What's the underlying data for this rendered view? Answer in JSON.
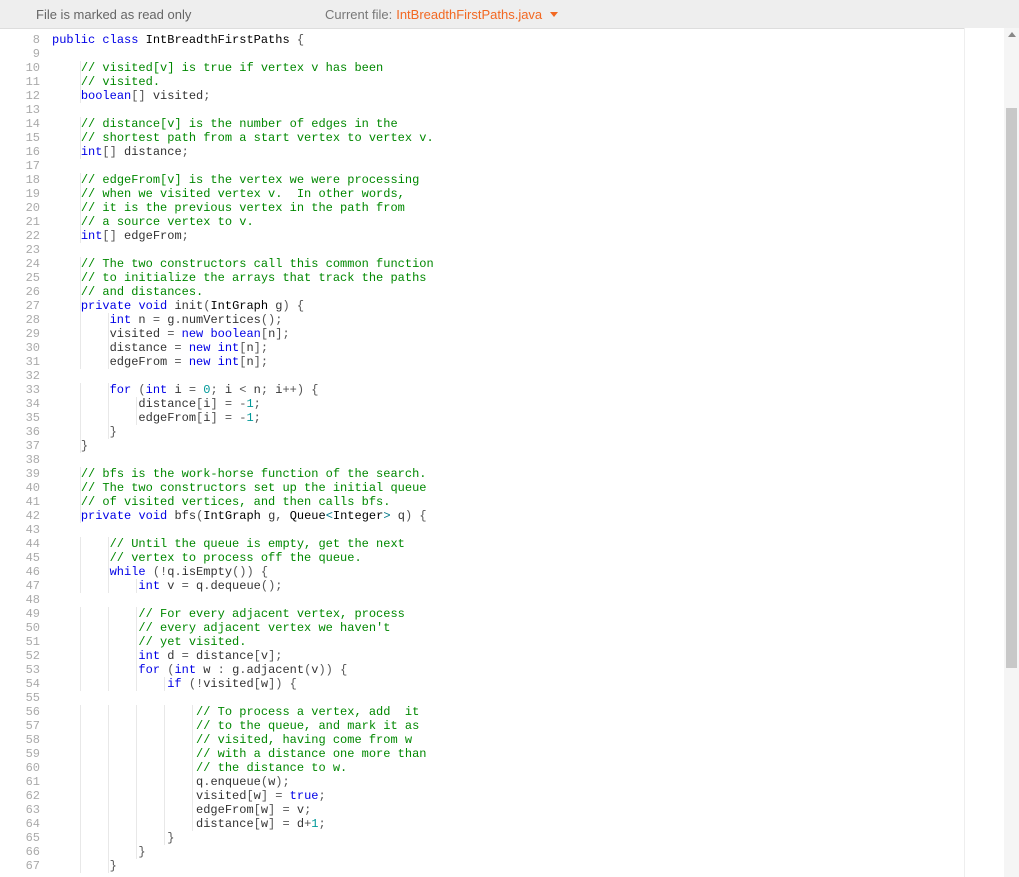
{
  "topbar": {
    "readonly_msg": "File is marked as read only",
    "current_label": "Current file:",
    "current_file": "IntBreadthFirstPaths.java"
  },
  "gutter": {
    "start": 8,
    "end": 67
  },
  "code": {
    "lines": [
      [
        [
          "kw",
          "public"
        ],
        [
          "",
          ""
        ],
        [
          "kw",
          "class"
        ],
        [
          "",
          ""
        ],
        [
          "type",
          "IntBreadthFirstPaths"
        ],
        [
          "",
          ""
        ],
        [
          "punc",
          "{"
        ]
      ],
      [],
      [
        [
          "",
          "    "
        ],
        [
          "comment",
          "// visited[v] is true if vertex v has been"
        ]
      ],
      [
        [
          "",
          "    "
        ],
        [
          "comment",
          "// visited."
        ]
      ],
      [
        [
          "",
          "    "
        ],
        [
          "kw",
          "boolean"
        ],
        [
          "punc",
          "[]"
        ],
        [
          "",
          ""
        ],
        [
          "id",
          "visited"
        ],
        [
          "punc",
          ";"
        ]
      ],
      [],
      [
        [
          "",
          "    "
        ],
        [
          "comment",
          "// distance[v] is the number of edges in the"
        ]
      ],
      [
        [
          "",
          "    "
        ],
        [
          "comment",
          "// shortest path from a start vertex to vertex v."
        ]
      ],
      [
        [
          "",
          "    "
        ],
        [
          "kw",
          "int"
        ],
        [
          "punc",
          "[]"
        ],
        [
          "",
          ""
        ],
        [
          "id",
          "distance"
        ],
        [
          "punc",
          ";"
        ]
      ],
      [],
      [
        [
          "",
          "    "
        ],
        [
          "comment",
          "// edgeFrom[v] is the vertex we were processing"
        ]
      ],
      [
        [
          "",
          "    "
        ],
        [
          "comment",
          "// when we visited vertex v.  In other words,"
        ]
      ],
      [
        [
          "",
          "    "
        ],
        [
          "comment",
          "// it is the previous vertex in the path from"
        ]
      ],
      [
        [
          "",
          "    "
        ],
        [
          "comment",
          "// a source vertex to v."
        ]
      ],
      [
        [
          "",
          "    "
        ],
        [
          "kw",
          "int"
        ],
        [
          "punc",
          "[]"
        ],
        [
          "",
          ""
        ],
        [
          "id",
          "edgeFrom"
        ],
        [
          "punc",
          ";"
        ]
      ],
      [],
      [
        [
          "",
          "    "
        ],
        [
          "comment",
          "// The two constructors call this common function"
        ]
      ],
      [
        [
          "",
          "    "
        ],
        [
          "comment",
          "// to initialize the arrays that track the paths"
        ]
      ],
      [
        [
          "",
          "    "
        ],
        [
          "comment",
          "// and distances."
        ]
      ],
      [
        [
          "",
          "    "
        ],
        [
          "kw",
          "private"
        ],
        [
          "",
          ""
        ],
        [
          "kw",
          "void"
        ],
        [
          "",
          ""
        ],
        [
          "id",
          "init"
        ],
        [
          "punc",
          "("
        ],
        [
          "type",
          "IntGraph"
        ],
        [
          "",
          ""
        ],
        [
          "id",
          "g"
        ],
        [
          "punc",
          ")"
        ],
        [
          "",
          ""
        ],
        [
          "punc",
          "{"
        ]
      ],
      [
        [
          "",
          "        "
        ],
        [
          "kw",
          "int"
        ],
        [
          "",
          ""
        ],
        [
          "id",
          "n"
        ],
        [
          "",
          ""
        ],
        [
          "op",
          "="
        ],
        [
          "",
          ""
        ],
        [
          "id",
          "g"
        ],
        [
          "punc",
          "."
        ],
        [
          "id",
          "numVertices"
        ],
        [
          "punc",
          "();"
        ]
      ],
      [
        [
          "",
          "        "
        ],
        [
          "id",
          "visited"
        ],
        [
          "",
          ""
        ],
        [
          "op",
          "="
        ],
        [
          "",
          ""
        ],
        [
          "kw",
          "new"
        ],
        [
          "",
          ""
        ],
        [
          "kw",
          "boolean"
        ],
        [
          "punc",
          "["
        ],
        [
          "id",
          "n"
        ],
        [
          "punc",
          "];"
        ]
      ],
      [
        [
          "",
          "        "
        ],
        [
          "id",
          "distance"
        ],
        [
          "",
          ""
        ],
        [
          "op",
          "="
        ],
        [
          "",
          ""
        ],
        [
          "kw",
          "new"
        ],
        [
          "",
          ""
        ],
        [
          "kw",
          "int"
        ],
        [
          "punc",
          "["
        ],
        [
          "id",
          "n"
        ],
        [
          "punc",
          "];"
        ]
      ],
      [
        [
          "",
          "        "
        ],
        [
          "id",
          "edgeFrom"
        ],
        [
          "",
          ""
        ],
        [
          "op",
          "="
        ],
        [
          "",
          ""
        ],
        [
          "kw",
          "new"
        ],
        [
          "",
          ""
        ],
        [
          "kw",
          "int"
        ],
        [
          "punc",
          "["
        ],
        [
          "id",
          "n"
        ],
        [
          "punc",
          "];"
        ]
      ],
      [],
      [
        [
          "",
          "        "
        ],
        [
          "kw",
          "for"
        ],
        [
          "",
          ""
        ],
        [
          "punc",
          "("
        ],
        [
          "kw",
          "int"
        ],
        [
          "",
          ""
        ],
        [
          "id",
          "i"
        ],
        [
          "",
          ""
        ],
        [
          "op",
          "="
        ],
        [
          "",
          ""
        ],
        [
          "num",
          "0"
        ],
        [
          "punc",
          ";"
        ],
        [
          "",
          ""
        ],
        [
          "id",
          "i"
        ],
        [
          "",
          ""
        ],
        [
          "op",
          "<"
        ],
        [
          "",
          ""
        ],
        [
          "id",
          "n"
        ],
        [
          "punc",
          ";"
        ],
        [
          "",
          ""
        ],
        [
          "id",
          "i"
        ],
        [
          "op",
          "++"
        ],
        [
          "punc",
          ")"
        ],
        [
          "",
          ""
        ],
        [
          "punc",
          "{"
        ]
      ],
      [
        [
          "",
          "            "
        ],
        [
          "id",
          "distance"
        ],
        [
          "punc",
          "["
        ],
        [
          "id",
          "i"
        ],
        [
          "punc",
          "]"
        ],
        [
          "",
          ""
        ],
        [
          "op",
          "="
        ],
        [
          "",
          ""
        ],
        [
          "op",
          "-"
        ],
        [
          "num",
          "1"
        ],
        [
          "punc",
          ";"
        ]
      ],
      [
        [
          "",
          "            "
        ],
        [
          "id",
          "edgeFrom"
        ],
        [
          "punc",
          "["
        ],
        [
          "id",
          "i"
        ],
        [
          "punc",
          "]"
        ],
        [
          "",
          ""
        ],
        [
          "op",
          "="
        ],
        [
          "",
          ""
        ],
        [
          "op",
          "-"
        ],
        [
          "num",
          "1"
        ],
        [
          "punc",
          ";"
        ]
      ],
      [
        [
          "",
          "        "
        ],
        [
          "punc",
          "}"
        ]
      ],
      [
        [
          "",
          "    "
        ],
        [
          "punc",
          "}"
        ]
      ],
      [],
      [
        [
          "",
          "    "
        ],
        [
          "comment",
          "// bfs is the work-horse function of the search."
        ]
      ],
      [
        [
          "",
          "    "
        ],
        [
          "comment",
          "// The two constructors set up the initial queue"
        ]
      ],
      [
        [
          "",
          "    "
        ],
        [
          "comment",
          "// of visited vertices, and then calls bfs."
        ]
      ],
      [
        [
          "",
          "    "
        ],
        [
          "kw",
          "private"
        ],
        [
          "",
          ""
        ],
        [
          "kw",
          "void"
        ],
        [
          "",
          ""
        ],
        [
          "id",
          "bfs"
        ],
        [
          "punc",
          "("
        ],
        [
          "type",
          "IntGraph"
        ],
        [
          "",
          ""
        ],
        [
          "id",
          "g"
        ],
        [
          "punc",
          ","
        ],
        [
          "",
          ""
        ],
        [
          "type",
          "Queue"
        ],
        [
          "generic",
          "<"
        ],
        [
          "type",
          "Integer"
        ],
        [
          "generic",
          ">"
        ],
        [
          "",
          ""
        ],
        [
          "id",
          "q"
        ],
        [
          "punc",
          ")"
        ],
        [
          "",
          ""
        ],
        [
          "punc",
          "{"
        ]
      ],
      [],
      [
        [
          "",
          "        "
        ],
        [
          "comment",
          "// Until the queue is empty, get the next"
        ]
      ],
      [
        [
          "",
          "        "
        ],
        [
          "comment",
          "// vertex to process off the queue."
        ]
      ],
      [
        [
          "",
          "        "
        ],
        [
          "kw",
          "while"
        ],
        [
          "",
          ""
        ],
        [
          "punc",
          "("
        ],
        [
          "op",
          "!"
        ],
        [
          "id",
          "q"
        ],
        [
          "punc",
          "."
        ],
        [
          "id",
          "isEmpty"
        ],
        [
          "punc",
          "())"
        ],
        [
          "",
          ""
        ],
        [
          "punc",
          "{"
        ]
      ],
      [
        [
          "",
          "            "
        ],
        [
          "kw",
          "int"
        ],
        [
          "",
          ""
        ],
        [
          "id",
          "v"
        ],
        [
          "",
          ""
        ],
        [
          "op",
          "="
        ],
        [
          "",
          ""
        ],
        [
          "id",
          "q"
        ],
        [
          "punc",
          "."
        ],
        [
          "id",
          "dequeue"
        ],
        [
          "punc",
          "();"
        ]
      ],
      [],
      [
        [
          "",
          "            "
        ],
        [
          "comment",
          "// For every adjacent vertex, process"
        ]
      ],
      [
        [
          "",
          "            "
        ],
        [
          "comment",
          "// every adjacent vertex we haven't"
        ]
      ],
      [
        [
          "",
          "            "
        ],
        [
          "comment",
          "// yet visited."
        ]
      ],
      [
        [
          "",
          "            "
        ],
        [
          "kw",
          "int"
        ],
        [
          "",
          ""
        ],
        [
          "id",
          "d"
        ],
        [
          "",
          ""
        ],
        [
          "op",
          "="
        ],
        [
          "",
          ""
        ],
        [
          "id",
          "distance"
        ],
        [
          "punc",
          "["
        ],
        [
          "id",
          "v"
        ],
        [
          "punc",
          "];"
        ]
      ],
      [
        [
          "",
          "            "
        ],
        [
          "kw",
          "for"
        ],
        [
          "",
          ""
        ],
        [
          "punc",
          "("
        ],
        [
          "kw",
          "int"
        ],
        [
          "",
          ""
        ],
        [
          "id",
          "w"
        ],
        [
          "",
          ""
        ],
        [
          "op",
          ":"
        ],
        [
          "",
          ""
        ],
        [
          "id",
          "g"
        ],
        [
          "punc",
          "."
        ],
        [
          "id",
          "adjacent"
        ],
        [
          "punc",
          "("
        ],
        [
          "id",
          "v"
        ],
        [
          "punc",
          "))"
        ],
        [
          "",
          ""
        ],
        [
          "punc",
          "{"
        ]
      ],
      [
        [
          "",
          "                "
        ],
        [
          "kw",
          "if"
        ],
        [
          "",
          ""
        ],
        [
          "punc",
          "("
        ],
        [
          "op",
          "!"
        ],
        [
          "id",
          "visited"
        ],
        [
          "punc",
          "["
        ],
        [
          "id",
          "w"
        ],
        [
          "punc",
          "])"
        ],
        [
          "",
          ""
        ],
        [
          "punc",
          "{"
        ]
      ],
      [],
      [
        [
          "",
          "                    "
        ],
        [
          "comment",
          "// To process a vertex, add  it"
        ]
      ],
      [
        [
          "",
          "                    "
        ],
        [
          "comment",
          "// to the queue, and mark it as"
        ]
      ],
      [
        [
          "",
          "                    "
        ],
        [
          "comment",
          "// visited, having come from w"
        ]
      ],
      [
        [
          "",
          "                    "
        ],
        [
          "comment",
          "// with a distance one more than"
        ]
      ],
      [
        [
          "",
          "                    "
        ],
        [
          "comment",
          "// the distance to w."
        ]
      ],
      [
        [
          "",
          "                    "
        ],
        [
          "id",
          "q"
        ],
        [
          "punc",
          "."
        ],
        [
          "id",
          "enqueue"
        ],
        [
          "punc",
          "("
        ],
        [
          "id",
          "w"
        ],
        [
          "punc",
          ");"
        ]
      ],
      [
        [
          "",
          "                    "
        ],
        [
          "id",
          "visited"
        ],
        [
          "punc",
          "["
        ],
        [
          "id",
          "w"
        ],
        [
          "punc",
          "]"
        ],
        [
          "",
          ""
        ],
        [
          "op",
          "="
        ],
        [
          "",
          ""
        ],
        [
          "bool",
          "true"
        ],
        [
          "punc",
          ";"
        ]
      ],
      [
        [
          "",
          "                    "
        ],
        [
          "id",
          "edgeFrom"
        ],
        [
          "punc",
          "["
        ],
        [
          "id",
          "w"
        ],
        [
          "punc",
          "]"
        ],
        [
          "",
          ""
        ],
        [
          "op",
          "="
        ],
        [
          "",
          ""
        ],
        [
          "id",
          "v"
        ],
        [
          "punc",
          ";"
        ]
      ],
      [
        [
          "",
          "                    "
        ],
        [
          "id",
          "distance"
        ],
        [
          "punc",
          "["
        ],
        [
          "id",
          "w"
        ],
        [
          "punc",
          "]"
        ],
        [
          "",
          ""
        ],
        [
          "op",
          "="
        ],
        [
          "",
          ""
        ],
        [
          "id",
          "d"
        ],
        [
          "op",
          "+"
        ],
        [
          "num",
          "1"
        ],
        [
          "punc",
          ";"
        ]
      ],
      [
        [
          "",
          "                "
        ],
        [
          "punc",
          "}"
        ]
      ],
      [
        [
          "",
          "            "
        ],
        [
          "punc",
          "}"
        ]
      ],
      [
        [
          "",
          "        "
        ],
        [
          "punc",
          "}"
        ]
      ]
    ]
  }
}
